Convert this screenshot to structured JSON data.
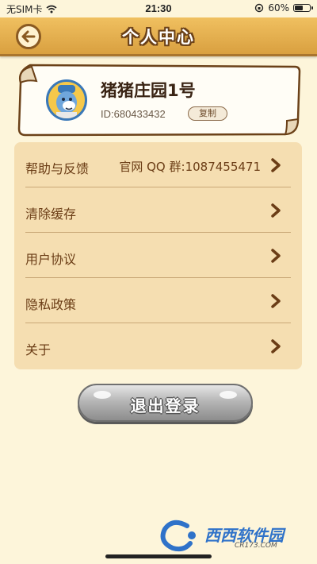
{
  "status_bar": {
    "carrier": "无SIM卡",
    "time": "21:30",
    "battery_percent": "60%",
    "battery_level": 0.6
  },
  "header": {
    "title": "个人中心",
    "back_icon": "back-arrow-icon",
    "bar_color": "#e0a84a"
  },
  "profile": {
    "nickname": "猪猪庄园1号",
    "id_text": "ID:680433432",
    "copy_label": "复制"
  },
  "menu": {
    "items": [
      {
        "label": "帮助与反馈",
        "value": "官网 QQ 群:1087455471"
      },
      {
        "label": "清除缓存",
        "value": ""
      },
      {
        "label": "用户协议",
        "value": ""
      },
      {
        "label": "隐私政策",
        "value": ""
      },
      {
        "label": "关于",
        "value": ""
      }
    ]
  },
  "logout": {
    "label": "退出登录"
  },
  "watermark": {
    "text": "西西软件园",
    "sub": "CR173.COM"
  }
}
